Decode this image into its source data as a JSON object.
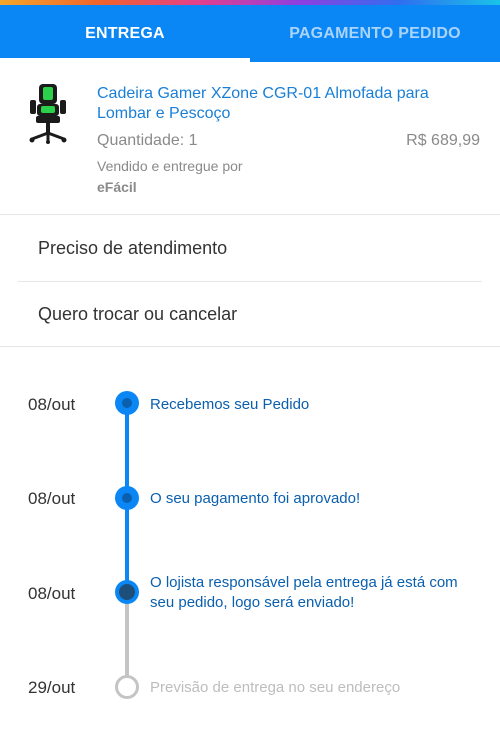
{
  "tabs": [
    {
      "label": "ENTREGA",
      "active": true
    },
    {
      "label": "PAGAMENTO PEDIDO",
      "active": false
    }
  ],
  "product": {
    "title": "Cadeira Gamer XZone CGR-01 Almofada para Lombar e Pescoço",
    "quantity": "Quantidade: 1",
    "price": "R$ 689,99",
    "seller_prefix": "Vendido e entregue por",
    "seller_name": "eFácil",
    "image_icon": "gaming-chair-image"
  },
  "menu": [
    {
      "label": "Preciso de atendimento"
    },
    {
      "label": "Quero trocar ou cancelar"
    }
  ],
  "timeline": [
    {
      "date": "08/out",
      "text": "Recebemos seu Pedido",
      "state": "done"
    },
    {
      "date": "08/out",
      "text": "O seu pagamento foi aprovado!",
      "state": "done"
    },
    {
      "date": "08/out",
      "text": "O lojista responsável pela entrega já está com seu pedido, logo será enviado!",
      "state": "current"
    },
    {
      "date": "29/out",
      "text": "Previsão de entrega no seu endereço",
      "state": "pending"
    }
  ],
  "colors": {
    "primary": "#0b86f5",
    "title_link": "#1a7fd6",
    "status_text": "#0a5faf",
    "pending": "#c4c4c4"
  }
}
